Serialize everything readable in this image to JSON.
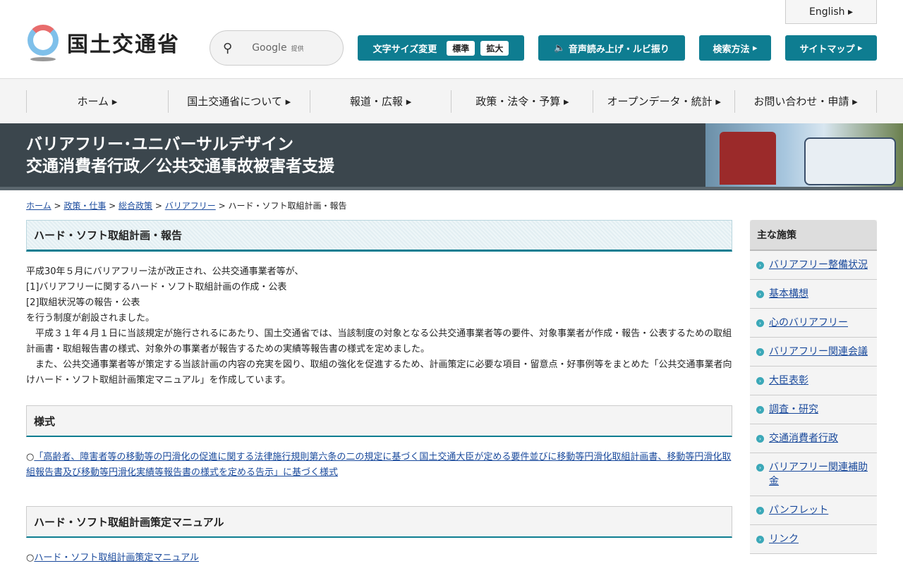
{
  "header": {
    "logo": "国土交通省",
    "search_label": "Google",
    "search_provider": "提供",
    "english": "English",
    "font_size_label": "文字サイズ変更",
    "font_standard": "標準",
    "font_large": "拡大",
    "speech": "音声読み上げ・ルビ振り",
    "search_method": "検索方法",
    "sitemap": "サイトマップ"
  },
  "nav": [
    "ホーム",
    "国土交通省について",
    "報道・広報",
    "政策・法令・予算",
    "オープンデータ・統計",
    "お問い合わせ・申請"
  ],
  "banner": {
    "line1": "バリアフリー･ユニバーサルデザイン",
    "line2": "交通消費者行政／公共交通事故被害者支援"
  },
  "breadcrumb": {
    "items": [
      "ホーム",
      "政策・仕事",
      "総合政策",
      "バリアフリー"
    ],
    "current": "ハード・ソフト取組計画・報告"
  },
  "main": {
    "title": "ハード・ソフト取組計画・報告",
    "intro": [
      "平成30年５月にバリアフリー法が改正され、公共交通事業者等が、",
      "[1]バリアフリーに関するハード・ソフト取組計画の作成・公表",
      "[2]取組状況等の報告・公表",
      "を行う制度が創設されました。",
      "　平成３１年４月１日に当該規定が施行されるにあたり、国土交通省では、当該制度の対象となる公共交通事業者等の要件、対象事業者が作成・報告・公表するための取組計画書・取組報告書の様式、対象外の事業者が報告するための実績等報告書の様式を定めました。",
      "　また、公共交通事業者等が策定する当該計画の内容の充実を図り、取組の強化を促進するため、計画策定に必要な項目・留意点・好事例等をまとめた「公共交通事業者向けハード・ソフト取組計画策定マニュアル」を作成しています。"
    ],
    "section1": {
      "title": "様式",
      "link": "「高齢者、障害者等の移動等の円滑化の促進に関する法律施行規則第六条の二の規定に基づく国土交通大臣が定める要件並びに移動等円滑化取組計画書、移動等円滑化取組報告書及び移動等円滑化実績等報告書の様式を定める告示」に基づく様式"
    },
    "section2": {
      "title": "ハード・ソフト取組計画策定マニュアル",
      "link": "ハード・ソフト取組計画策定マニュアル"
    }
  },
  "sidebar": {
    "title": "主な施策",
    "items": [
      "バリアフリー整備状況",
      "基本構想",
      "心のバリアフリー",
      "バリアフリー関連会議",
      "大臣表彰",
      "調査・研究",
      "交通消費者行政",
      "バリアフリー関連補助金",
      "パンフレット",
      "リンク"
    ]
  }
}
